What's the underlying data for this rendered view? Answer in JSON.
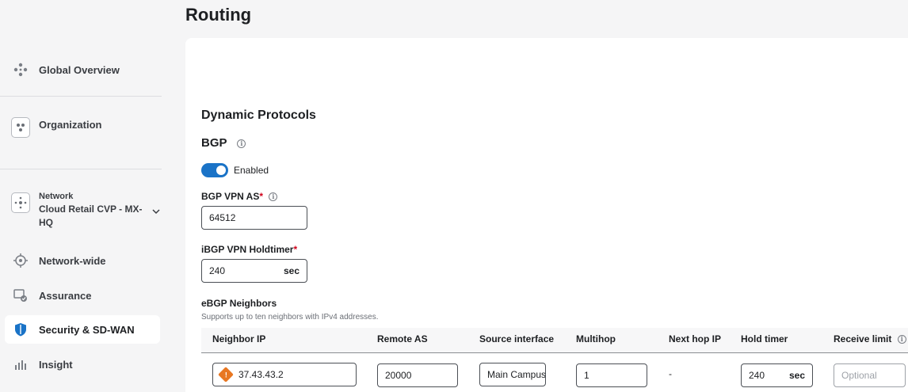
{
  "page": {
    "title": "Routing"
  },
  "sidebar": {
    "global_overview": "Global Overview",
    "organization": "Organization",
    "network_label": "Network",
    "network_name": "Cloud Retail CVP - MX-HQ",
    "network_wide": "Network-wide",
    "assurance": "Assurance",
    "security": "Security & SD-WAN",
    "insight": "Insight"
  },
  "main": {
    "section_title": "Dynamic Protocols",
    "bgp_title": "BGP",
    "bgp_toggle_label": "Enabled",
    "bgp_enabled": true,
    "vpn_as_label": "BGP VPN AS",
    "vpn_as_value": "64512",
    "holdtimer_label": "iBGP VPN Holdtimer",
    "holdtimer_value": "240",
    "holdtimer_unit": "sec",
    "required_mark": "*",
    "ebgp_title": "eBGP Neighbors",
    "ebgp_helper": "Supports up to ten neighbors with IPv4 addresses."
  },
  "table": {
    "headers": {
      "neighbor_ip": "Neighbor IP",
      "remote_as": "Remote AS",
      "source_interface": "Source interface",
      "multihop": "Multihop",
      "next_hop_ip": "Next hop IP",
      "hold_timer": "Hold timer",
      "receive_limit": "Receive limit"
    },
    "rows": [
      {
        "neighbor_ip": "37.43.43.2",
        "remote_as": "20000",
        "source_interface": "Main Campus",
        "multihop": "1",
        "next_hop_ip": "-",
        "hold_timer": "240",
        "hold_timer_unit": "sec",
        "receive_limit_placeholder": "Optional"
      }
    ]
  },
  "colors": {
    "accent": "#1a73c7",
    "active_icon": "#1a73c7",
    "warning": "#e87722",
    "required": "#d0021b"
  }
}
